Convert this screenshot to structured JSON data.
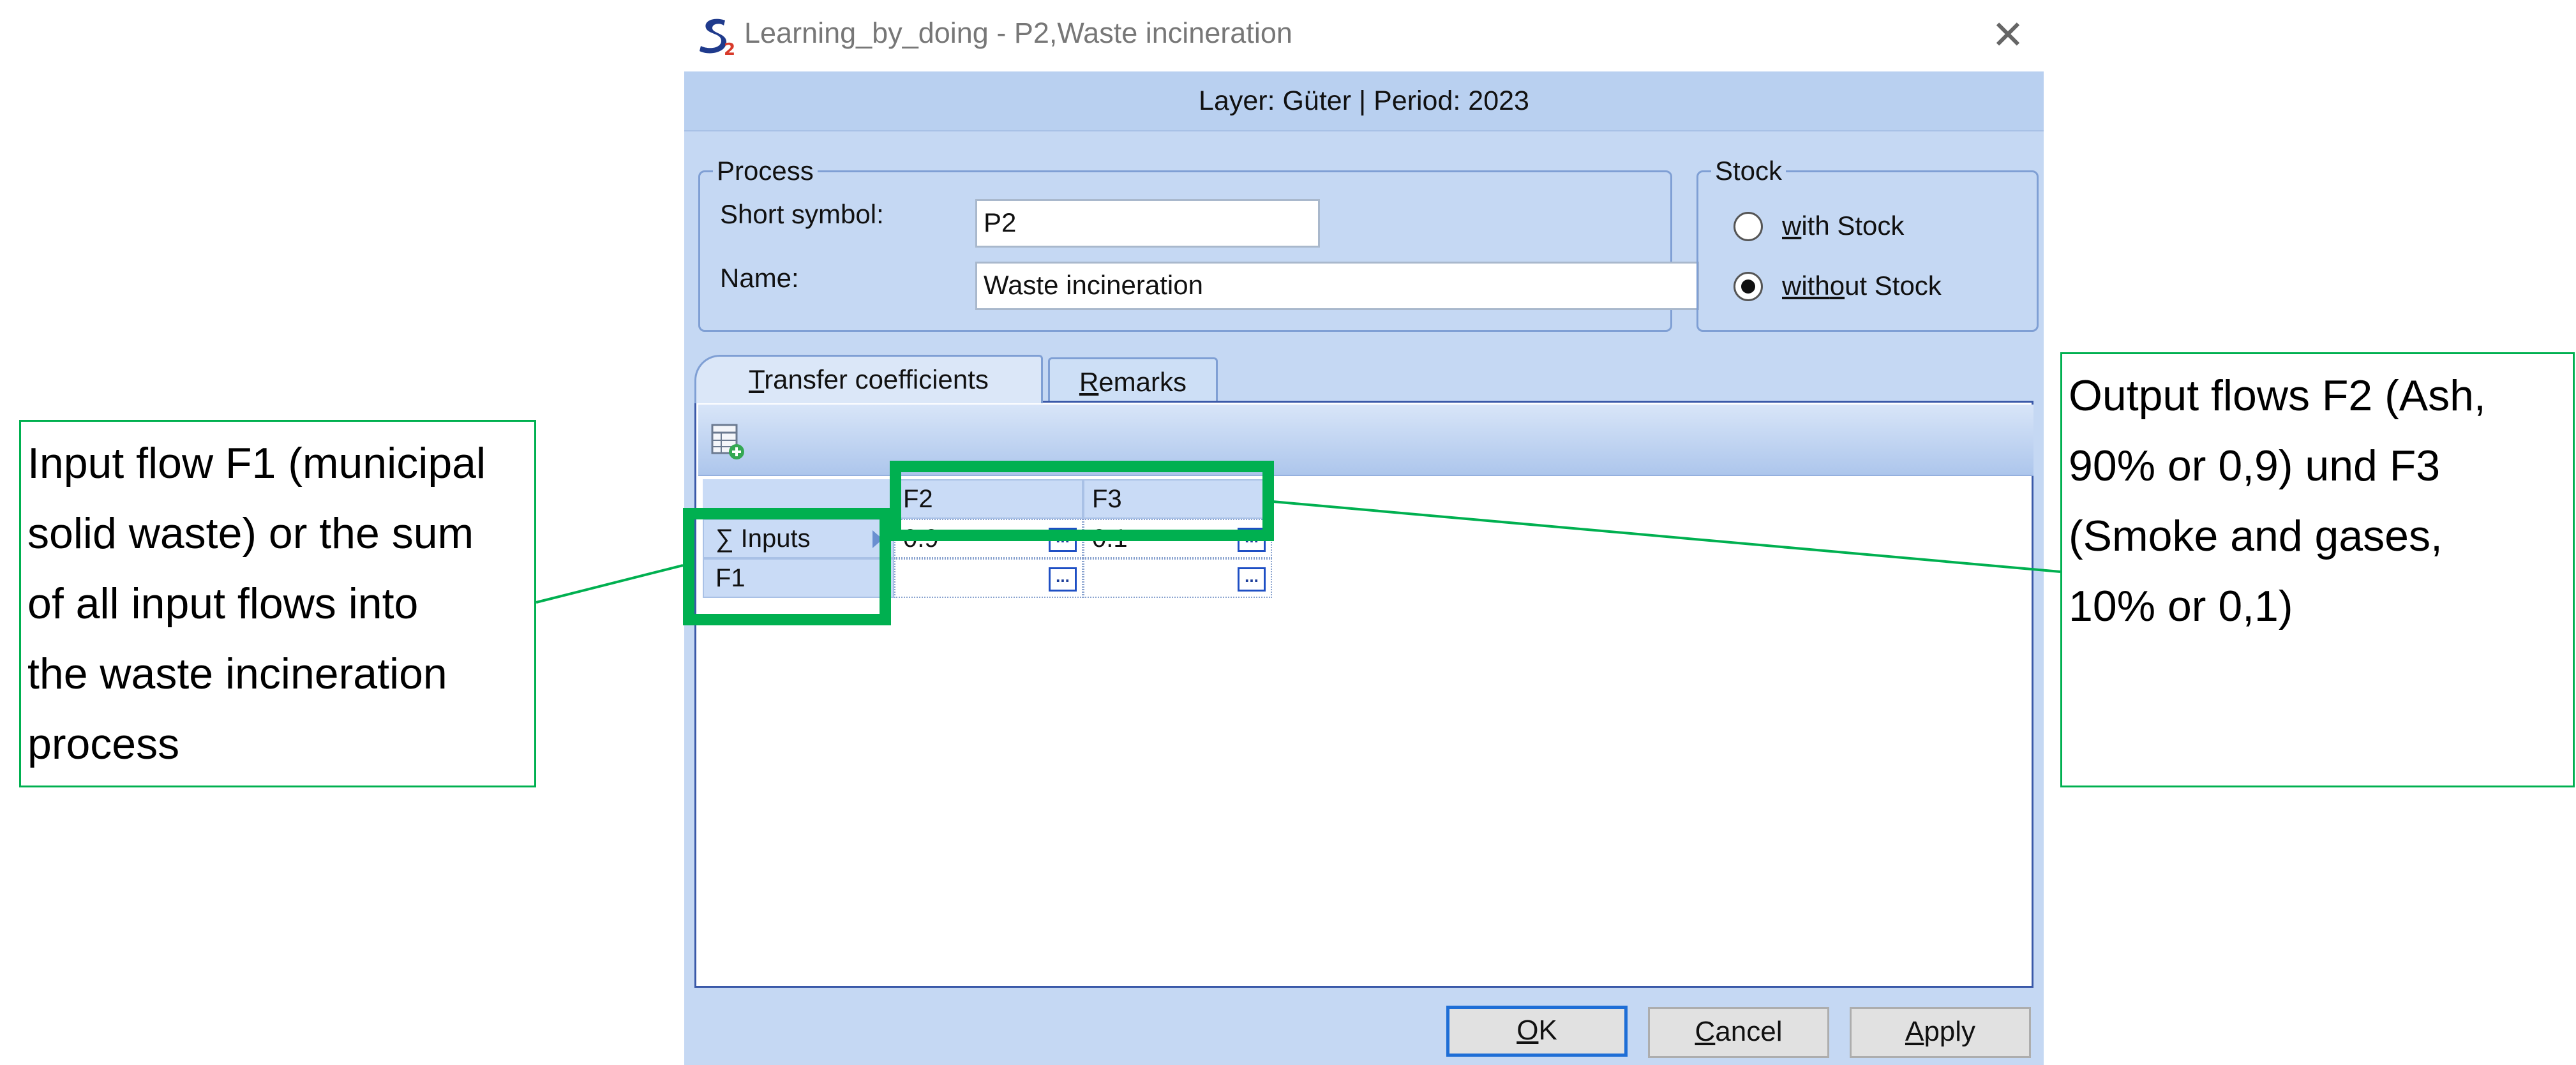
{
  "window": {
    "title": "Learning_by_doing - P2,Waste incineration",
    "close_symbol": "✕",
    "layer_period": "Layer: Güter | Period: 2023"
  },
  "process": {
    "legend": "Process",
    "short_symbol_label": "Short symbol:",
    "short_symbol_value": "P2",
    "name_label": "Name:",
    "name_value": "Waste incineration"
  },
  "stock": {
    "legend": "Stock",
    "with_stock_label_hotkey": "w",
    "with_stock_label_rest": "ith Stock",
    "without_stock_label_pre": "with",
    "without_stock_label_hotkey": "o",
    "without_stock_label_rest": "ut Stock",
    "selected": "without Stock"
  },
  "tabs": {
    "transfer_hotkey": "T",
    "transfer_rest": "ransfer coefficients",
    "remarks_hotkey": "R",
    "remarks_rest": "emarks",
    "active": "Transfer coefficients"
  },
  "grid": {
    "columns": [
      "F2",
      "F3"
    ],
    "rows": [
      {
        "header": "∑ Inputs",
        "values": [
          "0.9",
          "0.1"
        ]
      },
      {
        "header": "F1",
        "values": [
          "",
          ""
        ]
      }
    ],
    "ellipsis": "..."
  },
  "buttons": {
    "ok_hotkey": "O",
    "ok_rest": "K",
    "cancel_hotkey": "C",
    "cancel_rest": "ancel",
    "apply_hotkey": "A",
    "apply_rest": "pply"
  },
  "annotations": {
    "input_callout_lines": [
      "Input flow F1 (municipal",
      "solid waste) or the sum",
      "of all input flows into",
      "the waste incineration",
      "process"
    ],
    "output_callout_lines": [
      "Output flows F2 (Ash,",
      "90% or 0,9) und F3",
      "(Smoke and gases,",
      "10% or 0,1)"
    ],
    "accent_color": "#00b050"
  },
  "icons": {
    "app_logo": "s2-logo-icon",
    "close": "close-icon",
    "grid_add": "grid-add-icon"
  }
}
